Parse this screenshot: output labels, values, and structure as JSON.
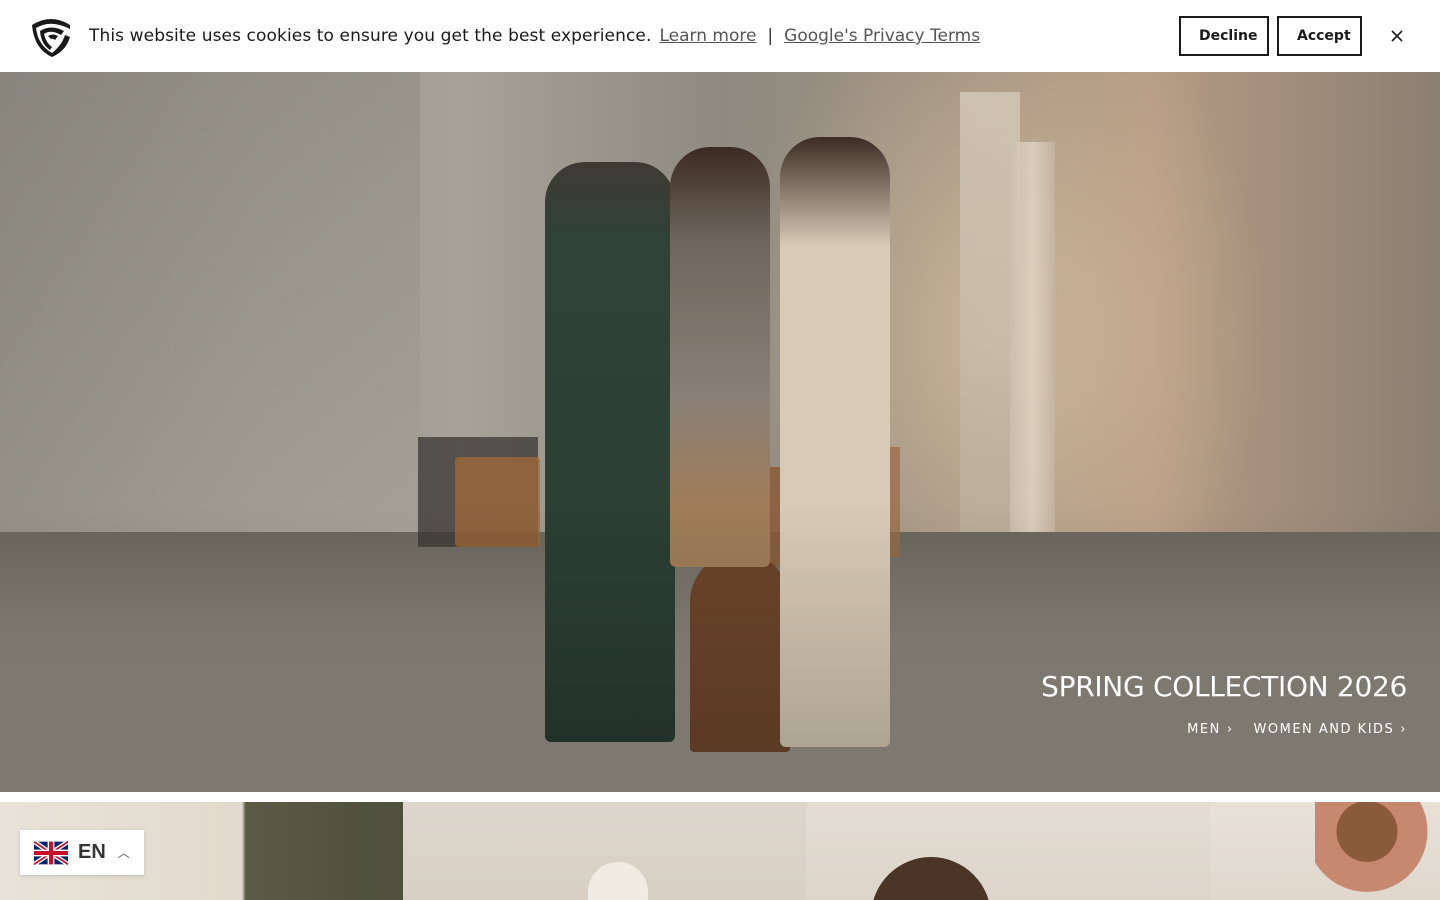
{
  "cookie_banner": {
    "message": "This website uses cookies to ensure you get the best experience.",
    "learn_more": "Learn more",
    "separator": "|",
    "privacy_terms": "Google's Privacy Terms",
    "decline_label": "Decline",
    "accept_label": "Accept",
    "close_icon": "close-icon",
    "logo_icon": "shield-logo-icon"
  },
  "hero": {
    "title": "SPRING COLLECTION 2026",
    "links": [
      {
        "label": "MEN",
        "icon": "chevron-right-icon"
      },
      {
        "label": "WOMEN AND KIDS",
        "icon": "chevron-right-icon"
      }
    ]
  },
  "language_switcher": {
    "code": "EN",
    "flag": "uk-flag-icon",
    "chevron": "chevron-up-icon"
  },
  "colors": {
    "text_dark": "#1a1a1a",
    "link_gray": "#555555",
    "hero_text": "#ffffff"
  }
}
